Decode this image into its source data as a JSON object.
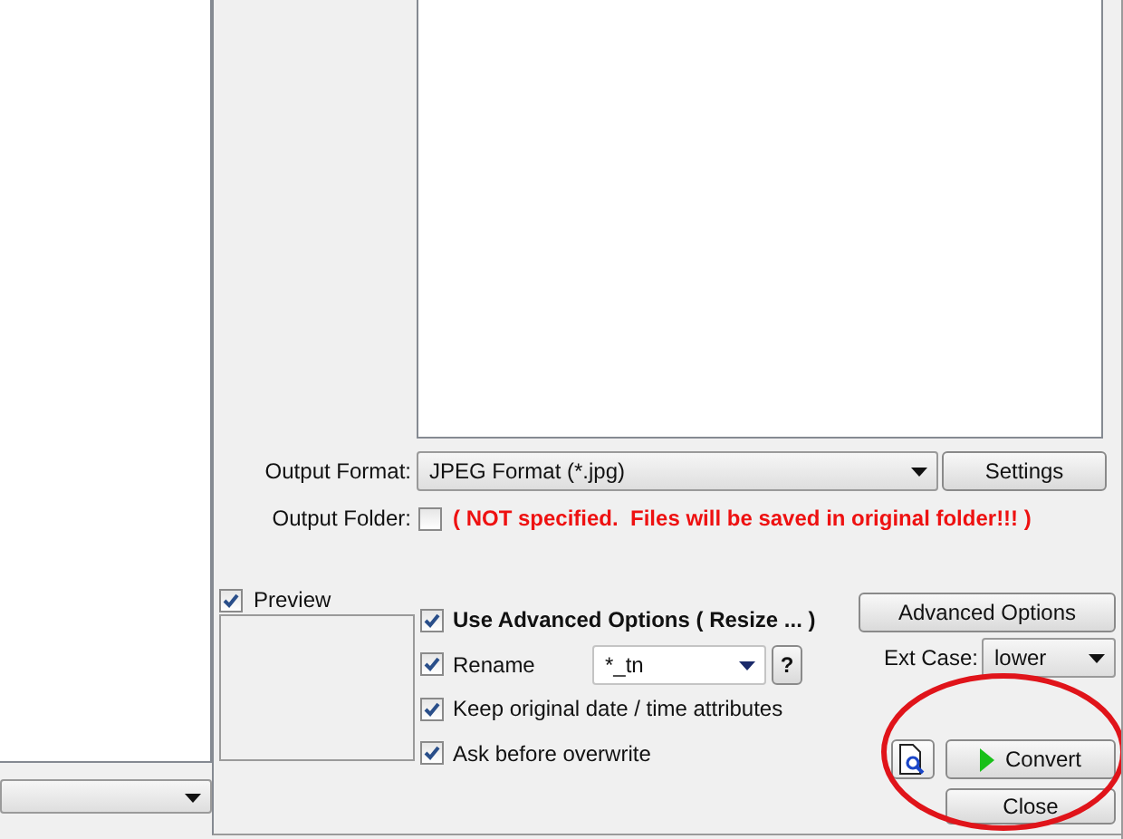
{
  "output_format": {
    "label": "Output Format:",
    "value": "JPEG Format (*.jpg)",
    "button": "Settings"
  },
  "output_folder": {
    "label": "Output Folder:",
    "checked": false,
    "message": "( NOT specified.  Files will be saved in original folder!!! )"
  },
  "preview": {
    "label": "Preview",
    "checked": true
  },
  "options": [
    {
      "kind": "check",
      "label": "Use Advanced Options ( Resize ... )",
      "checked": true,
      "bold": true
    },
    {
      "kind": "rename",
      "label": "Rename",
      "checked": true,
      "bold": false,
      "value": "*_tn",
      "help": "?"
    },
    {
      "kind": "check",
      "label": "Keep original date / time attributes",
      "checked": true,
      "bold": false
    },
    {
      "kind": "check",
      "label": "Ask before overwrite",
      "checked": true,
      "bold": false
    }
  ],
  "advanced_button": "Advanced Options",
  "ext_case": {
    "label": "Ext Case:",
    "value": "lower"
  },
  "convert_button": "Convert",
  "close_button": "Close",
  "annotation": {
    "kind": "ellipse"
  }
}
